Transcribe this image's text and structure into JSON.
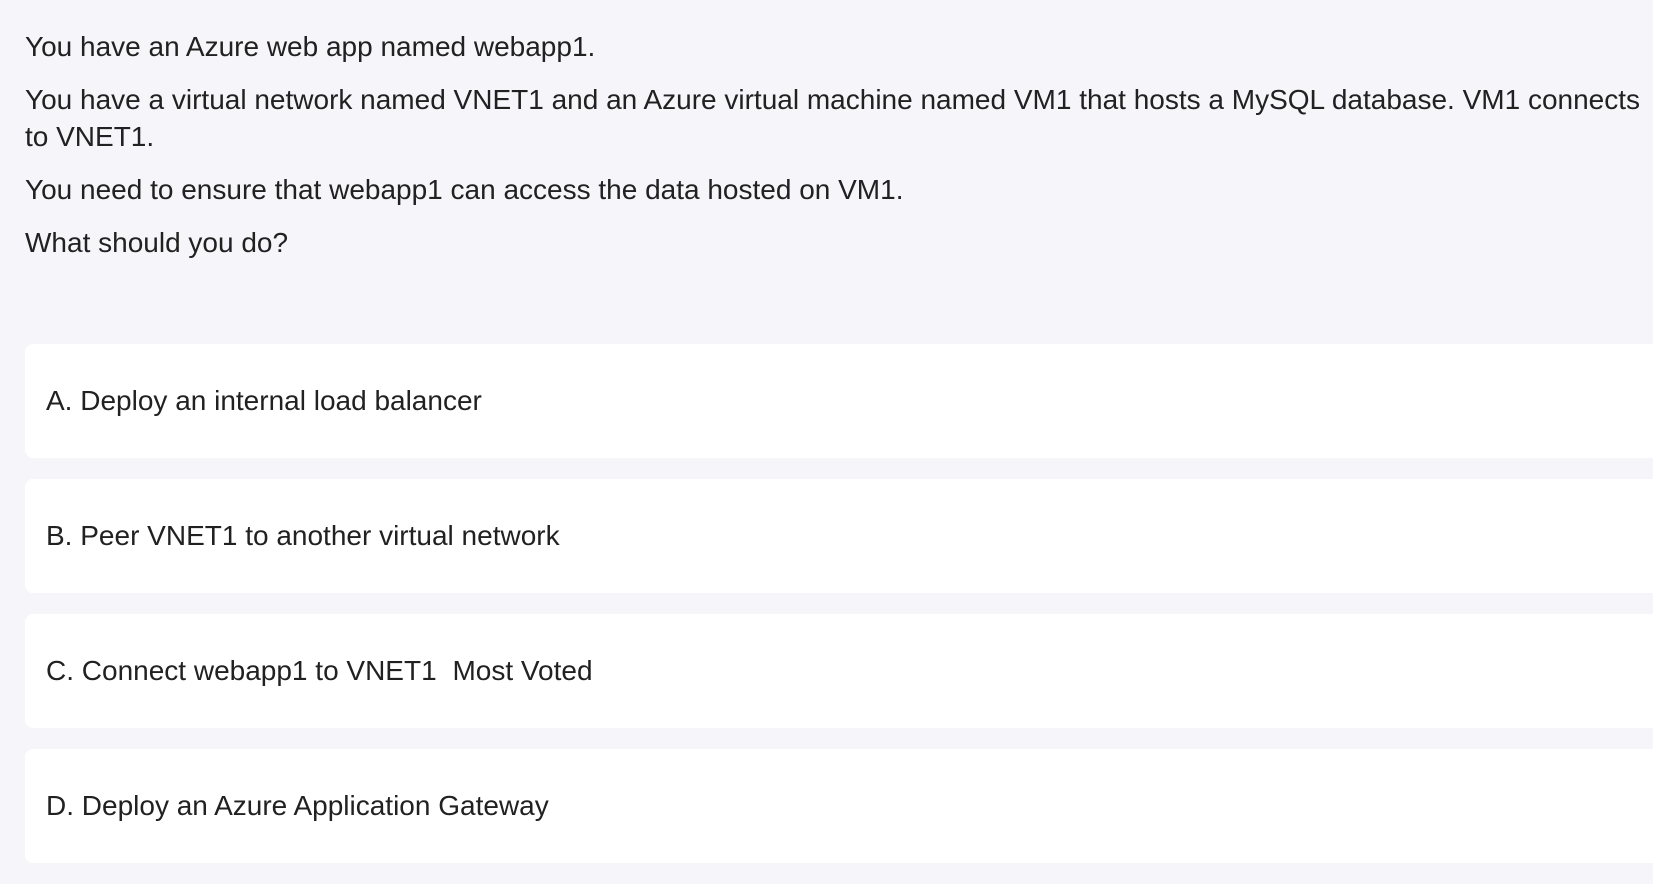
{
  "question": {
    "paragraphs": [
      "You have an Azure web app named webapp1.",
      "You have a virtual network named VNET1 and an Azure virtual machine named VM1 that hosts a MySQL database. VM1 connects to VNET1.",
      "You need to ensure that webapp1 can access the data hosted on VM1.",
      "What should you do?"
    ]
  },
  "options": [
    {
      "letter": "A.",
      "text": "Deploy an internal load balancer",
      "badge": ""
    },
    {
      "letter": "B.",
      "text": "Peer VNET1 to another virtual network",
      "badge": ""
    },
    {
      "letter": "C.",
      "text": "Connect webapp1 to VNET1",
      "badge": "Most Voted"
    },
    {
      "letter": "D.",
      "text": "Deploy an Azure Application Gateway",
      "badge": ""
    }
  ],
  "colors": {
    "background": "#f5f5fa",
    "card": "#ffffff",
    "text": "#212121"
  }
}
